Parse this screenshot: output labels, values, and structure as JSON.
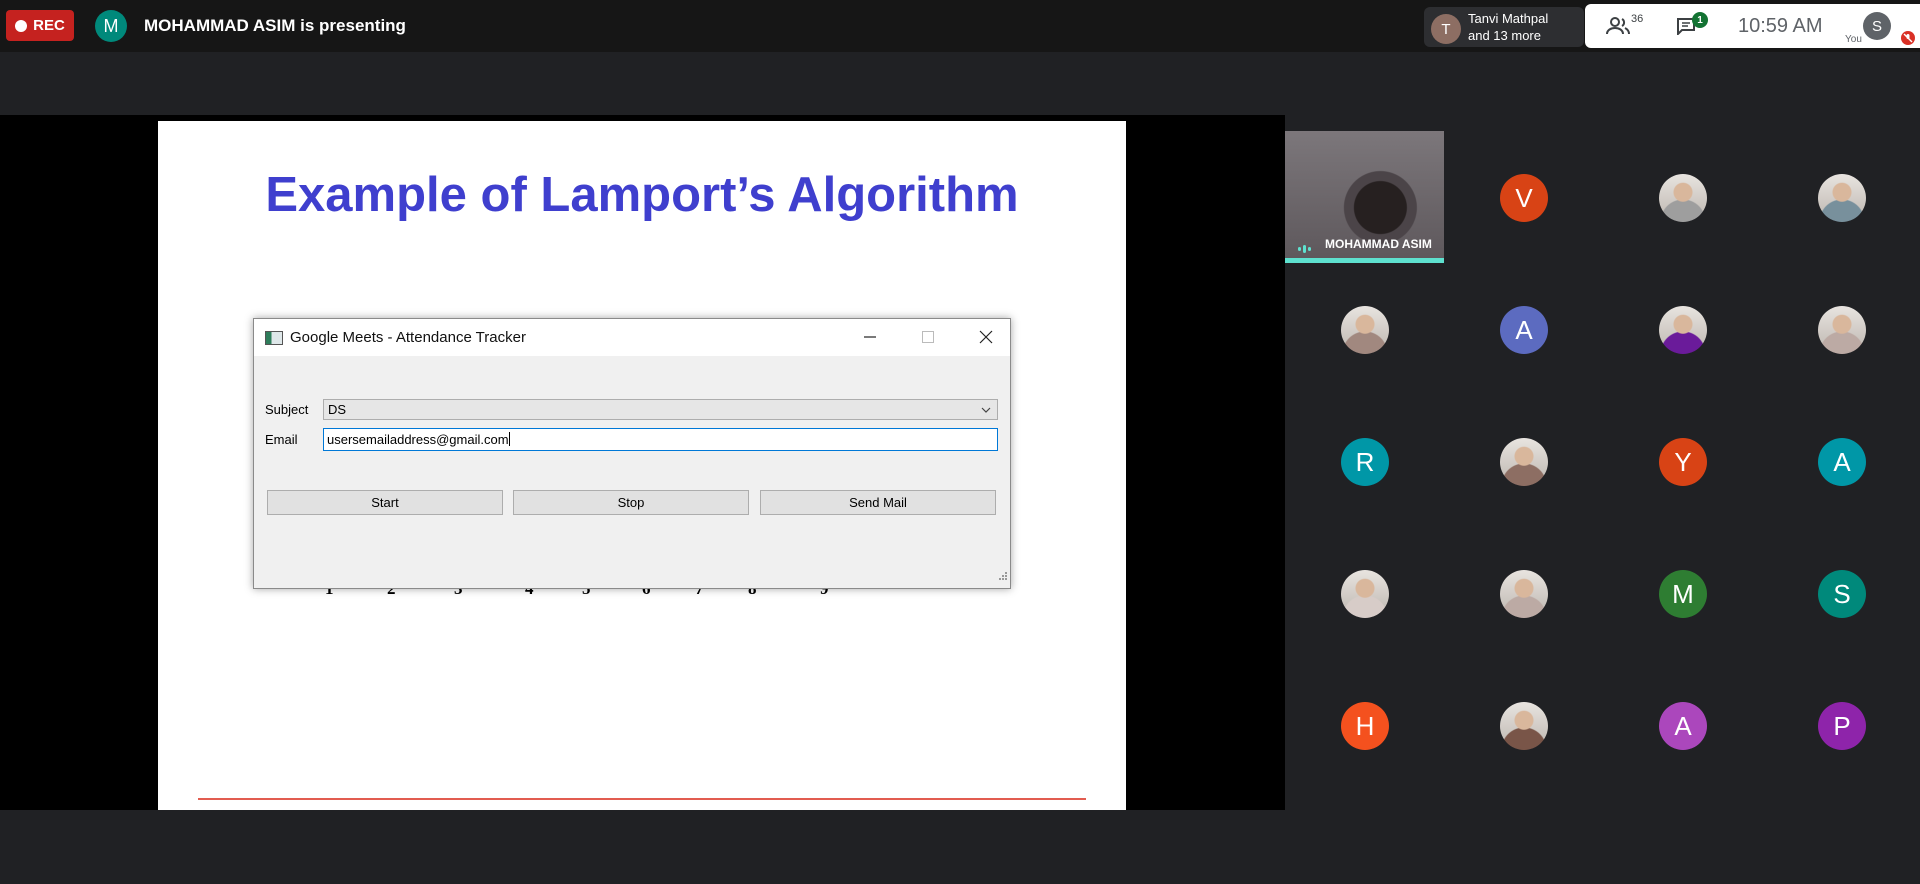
{
  "meeting": {
    "rec_label": "REC",
    "presenter_initial": "M",
    "presenting_text": "MOHAMMAD ASIM is presenting",
    "participants_chip": {
      "initial": "T",
      "line1": "Tanvi Mathpal",
      "line2": "and 13 more"
    },
    "people_count": "36",
    "chat_badge": "1",
    "clock": "10:59  AM",
    "self_initial": "S",
    "self_label": "You"
  },
  "slide": {
    "title": "Example of Lamport’s Algorithm",
    "numbers": [
      "1",
      "2",
      "3",
      "4",
      "5",
      "6",
      "7",
      "8",
      "9"
    ]
  },
  "app_window": {
    "title": "Google Meets - Attendance Tracker",
    "subject_label": "Subject",
    "subject_value": "DS",
    "email_label": "Email",
    "email_value": "usersemailaddress@gmail.com",
    "buttons": {
      "start": "Start",
      "stop": "Stop",
      "send": "Send Mail"
    }
  },
  "active_speaker": {
    "name": "MOHAMMAD ASIM"
  },
  "participants": [
    {
      "initial": "V",
      "color": "#d84315"
    },
    {
      "photo": true,
      "color": "#9e9e9e"
    },
    {
      "photo": true,
      "color": "#78909c"
    },
    {
      "photo": true,
      "color": "#a1887f"
    },
    {
      "initial": "A",
      "color": "#5c6bc0"
    },
    {
      "photo": true,
      "color": "#6a1b9a"
    },
    {
      "photo": true,
      "color": "#bcaaa4"
    },
    {
      "initial": "R",
      "color": "#0097a7"
    },
    {
      "photo": true,
      "color": "#8d6e63"
    },
    {
      "initial": "Y",
      "color": "#d84315"
    },
    {
      "initial": "A",
      "color": "#0097a7"
    },
    {
      "photo": true,
      "color": "#d7ccc8"
    },
    {
      "photo": true,
      "color": "#bcaaa4"
    },
    {
      "initial": "M",
      "color": "#2e7d32"
    },
    {
      "initial": "S",
      "color": "#00897b"
    },
    {
      "initial": "H",
      "color": "#f4511e"
    },
    {
      "photo": true,
      "color": "#795548"
    },
    {
      "initial": "A",
      "color": "#ab47bc"
    },
    {
      "initial": "P",
      "color": "#8e24aa"
    }
  ]
}
